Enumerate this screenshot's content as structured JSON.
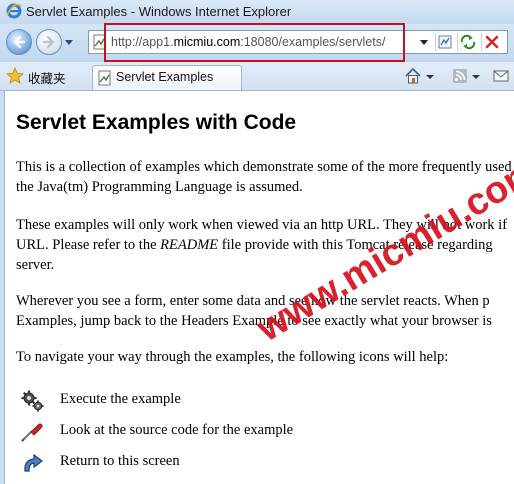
{
  "window": {
    "title": "Servlet Examples - Windows Internet Explorer"
  },
  "address_bar": {
    "url_prefix": "http://app1.",
    "url_host": "micmiu.com",
    "url_rest": ":18080/examples/servlets/"
  },
  "favorites_bar": {
    "favorites_label": "收藏夹",
    "tab_label": "Servlet Examples"
  },
  "page": {
    "title": "Servlet Examples with Code",
    "paragraphs": [
      {
        "line1": "This is a collection of examples which demonstrate some of the more frequently used",
        "line2": "the Java(tm) Programming Language is assumed."
      },
      {
        "line1": "These examples will only work when viewed via an http URL. They will not work if",
        "line2_before": "URL. Please refer to the ",
        "line2_italic": "README",
        "line2_after": " file provide with this Tomcat release regarding",
        "line3": "server."
      },
      {
        "line1": "Wherever you see a form, enter some data and see how the servlet reacts. When p",
        "line2": "Examples, jump back to the Headers Example to see exactly what your browser is"
      },
      {
        "line1": "To navigate your way through the examples, the following icons will help:"
      }
    ],
    "icon_rows": [
      {
        "icon": "gears-icon",
        "label": "Execute the example"
      },
      {
        "icon": "screwdriver-icon",
        "label": "Look at the source code for the example"
      },
      {
        "icon": "return-arrow-icon",
        "label": "Return to this screen"
      }
    ]
  },
  "watermark": "www.micmiu.com",
  "colors": {
    "highlight_border": "#c0141a",
    "watermark": "#d6101c"
  }
}
